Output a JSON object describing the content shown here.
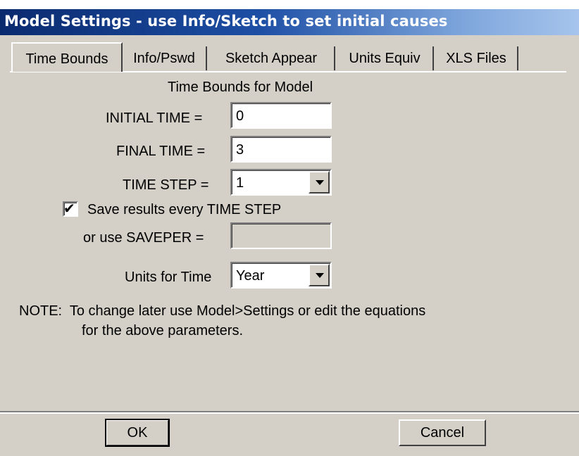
{
  "window": {
    "title": "Model Settings - use Info/Sketch to set initial causes"
  },
  "tabs": [
    {
      "label": "Time Bounds",
      "active": true
    },
    {
      "label": "Info/Pswd",
      "active": false
    },
    {
      "label": "Sketch Appear",
      "active": false
    },
    {
      "label": "Units Equiv",
      "active": false
    },
    {
      "label": "XLS Files",
      "active": false
    }
  ],
  "form": {
    "heading": "Time Bounds for Model",
    "initial_time_label": "INITIAL TIME =",
    "initial_time_value": "0",
    "final_time_label": "FINAL TIME =",
    "final_time_value": "3",
    "time_step_label": "TIME STEP =",
    "time_step_value": "1",
    "save_checkbox_label": "Save results every TIME STEP",
    "save_checked": true,
    "saveper_label": "or use SAVEPER =",
    "saveper_value": "",
    "units_label": "Units for Time",
    "units_value": "Year",
    "note_line1": "NOTE:  To change later use Model>Settings or edit the equations",
    "note_line2": "for the above parameters."
  },
  "buttons": {
    "ok": "OK",
    "cancel": "Cancel"
  },
  "icons": {
    "dropdown": "chevron-down-icon",
    "check": "check-icon"
  }
}
